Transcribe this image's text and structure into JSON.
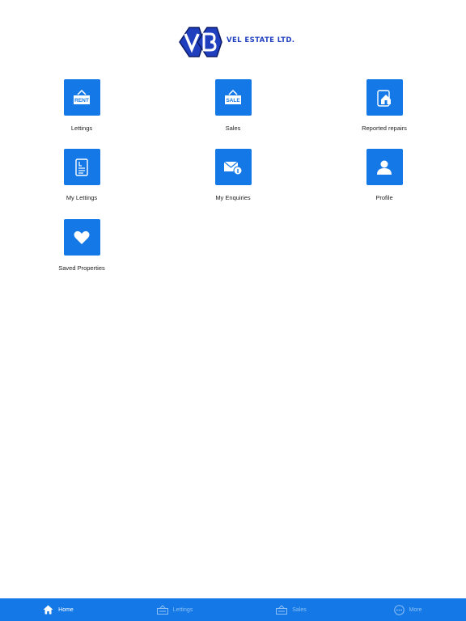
{
  "brand": {
    "name": "VEL ESTATE LTD.",
    "accent": "#1479e6"
  },
  "tiles": [
    {
      "label": "Lettings",
      "icon": "rent-sign-icon"
    },
    {
      "label": "Sales",
      "icon": "sale-sign-icon"
    },
    {
      "label": "Reported repairs",
      "icon": "house-repair-icon"
    },
    {
      "label": "My Lettings",
      "icon": "document-icon"
    },
    {
      "label": "My Enquiries",
      "icon": "mail-info-icon"
    },
    {
      "label": "Profile",
      "icon": "person-icon"
    },
    {
      "label": "Saved Properties",
      "icon": "heart-icon"
    }
  ],
  "icon_text": {
    "rent": "RENT",
    "sale": "SALE"
  },
  "tabbar": [
    {
      "label": "Home",
      "icon": "home-icon",
      "active": true
    },
    {
      "label": "Lettings",
      "icon": "rent-sign-icon",
      "active": false
    },
    {
      "label": "Sales",
      "icon": "sale-sign-icon",
      "active": false
    },
    {
      "label": "More",
      "icon": "more-icon",
      "active": false
    }
  ]
}
